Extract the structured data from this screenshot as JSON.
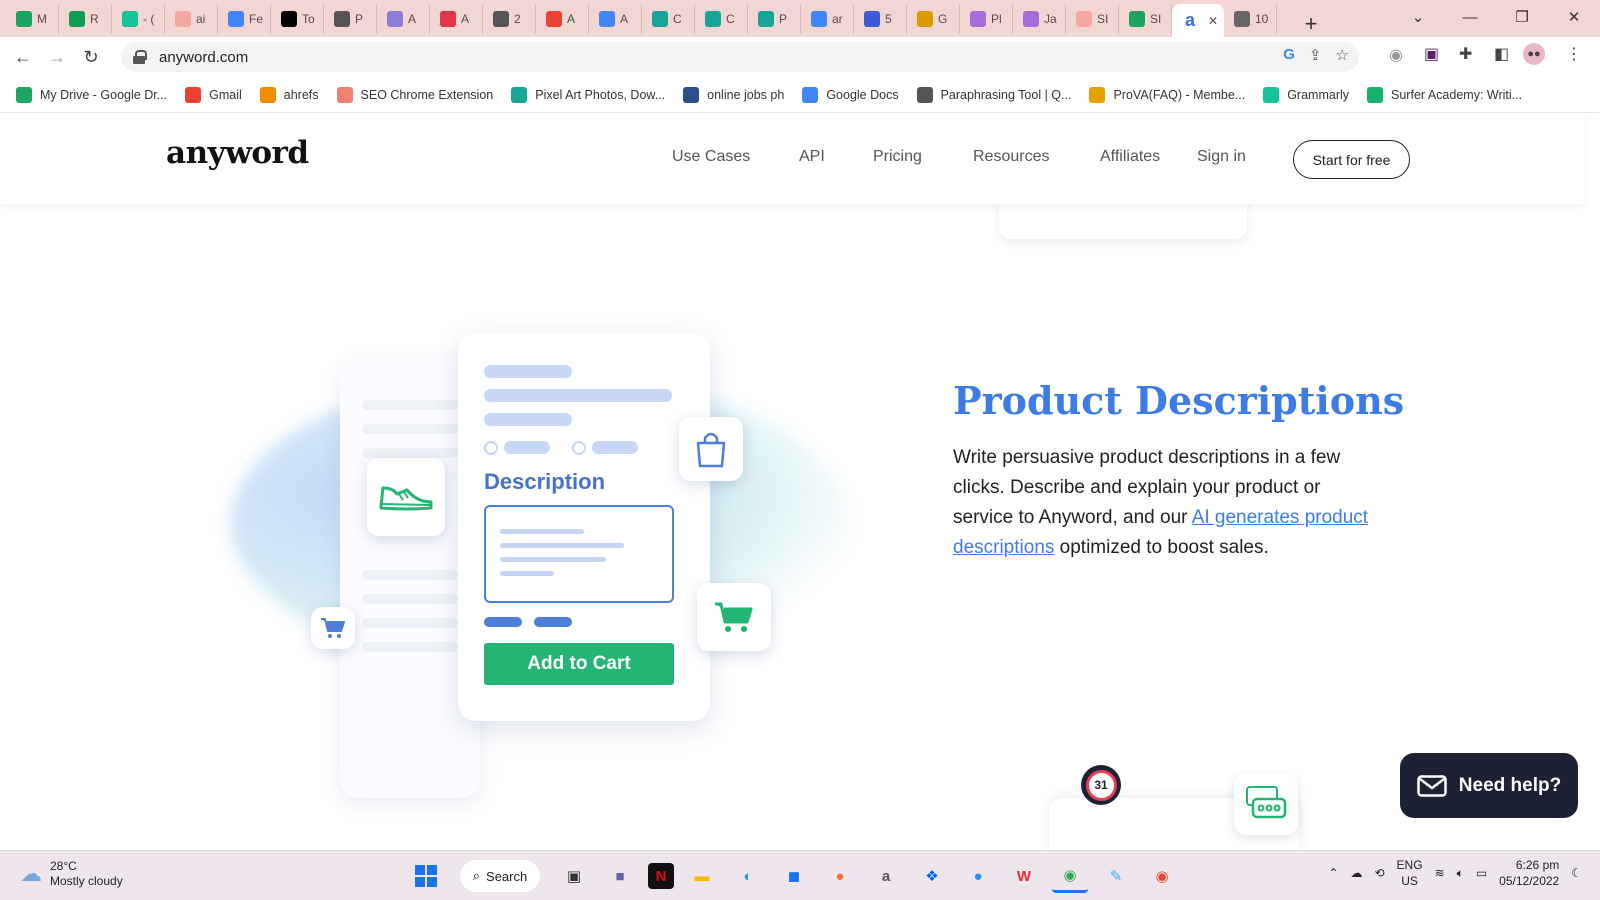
{
  "browser": {
    "tabs": [
      {
        "label": "M",
        "icon": "google-drive-icon",
        "color": "#1fa463"
      },
      {
        "label": "R",
        "icon": "sheets-icon",
        "color": "#0f9d58"
      },
      {
        "label": "- (",
        "icon": "grammarly-icon",
        "color": "#15c39a"
      },
      {
        "label": "ai",
        "icon": "doc-icon",
        "color": "#f4a7a0"
      },
      {
        "label": "Fe",
        "icon": "google-icon",
        "color": "#4285f4"
      },
      {
        "label": "To",
        "icon": "medium-icon",
        "color": "#000000"
      },
      {
        "label": "P",
        "icon": "quill-icon",
        "color": "#555555"
      },
      {
        "label": "A",
        "icon": "k-icon",
        "color": "#8b7ed8"
      },
      {
        "label": "A",
        "icon": "zyro-icon",
        "color": "#e3364b"
      },
      {
        "label": "2",
        "icon": "scissor-icon",
        "color": "#555555"
      },
      {
        "label": "A",
        "icon": "g-red-icon",
        "color": "#ea4335"
      },
      {
        "label": "A",
        "icon": "google-docs-icon",
        "color": "#4285f4"
      },
      {
        "label": "C",
        "icon": "pixel-icon",
        "color": "#18a497"
      },
      {
        "label": "C",
        "icon": "pixel-icon",
        "color": "#18a497"
      },
      {
        "label": "P",
        "icon": "pixel-icon",
        "color": "#18a497"
      },
      {
        "label": "ar",
        "icon": "google-icon",
        "color": "#4285f4"
      },
      {
        "label": "5",
        "icon": "bars-icon",
        "color": "#3d5ad8"
      },
      {
        "label": "G",
        "icon": "ttu-icon",
        "color": "#d99a00"
      },
      {
        "label": "Pl",
        "icon": "circle-icon",
        "color": "#a66cd8"
      },
      {
        "label": "Ja",
        "icon": "circle-icon",
        "color": "#a66cd8"
      },
      {
        "label": "SI",
        "icon": "doc-icon",
        "color": "#f4a7a0"
      },
      {
        "label": "SI",
        "icon": "google-drive-icon",
        "color": "#1fa463"
      },
      {
        "label": "",
        "icon": "anyword-icon",
        "color": "#3b6fe0",
        "active": true
      },
      {
        "label": "10",
        "icon": "globe-icon",
        "color": "#666666"
      }
    ],
    "new_tab": "+",
    "url": "anyword.com",
    "bookmarks": [
      {
        "label": "My Drive - Google Dr...",
        "icon": "google-drive-icon",
        "color": "#1fa463"
      },
      {
        "label": "Gmail",
        "icon": "gmail-icon",
        "color": "#ea4335"
      },
      {
        "label": "ahrefs",
        "icon": "ahrefs-icon",
        "color": "#f28b00"
      },
      {
        "label": "SEO Chrome Extension",
        "icon": "seo-icon",
        "color": "#f08070"
      },
      {
        "label": "Pixel Art Photos, Dow...",
        "icon": "pixel-icon",
        "color": "#18a497"
      },
      {
        "label": "online jobs ph",
        "icon": "onlinejobs-icon",
        "color": "#2b4f8c"
      },
      {
        "label": "Google Docs",
        "icon": "google-docs-icon",
        "color": "#4285f4"
      },
      {
        "label": "Paraphrasing Tool | Q...",
        "icon": "quill-icon",
        "color": "#555555"
      },
      {
        "label": "ProVA(FAQ) - Membe...",
        "icon": "prova-icon",
        "color": "#e8a200"
      },
      {
        "label": "Grammarly",
        "icon": "grammarly-icon",
        "color": "#15c39a"
      },
      {
        "label": "Surfer Academy: Writi...",
        "icon": "surfer-icon",
        "color": "#17b26a"
      }
    ]
  },
  "site": {
    "logo": "anyword",
    "nav": [
      "Use Cases",
      "API",
      "Pricing",
      "Resources",
      "Affiliates",
      "Sign in"
    ],
    "cta": "Start for free",
    "illustration": {
      "description_label": "Description",
      "button_label": "Add to Cart"
    },
    "section": {
      "heading": "Product Descriptions",
      "text_before": "Write persuasive product descriptions in a few clicks. Describe and explain your product or service to Anyword, and our ",
      "link_text": "AI generates product descriptions",
      "text_after": " optimized to boost sales."
    },
    "badge_number": "31",
    "help_button": "Need help?",
    "colors": {
      "accent": "#3d7be6",
      "cta_green": "#22b573",
      "dark": "#1c2233"
    }
  },
  "taskbar": {
    "weather_temp": "28°C",
    "weather_desc": "Mostly cloudy",
    "search_label": "Search",
    "lang_top": "ENG",
    "lang_bottom": "US",
    "time": "6:26 pm",
    "date": "05/12/2022"
  }
}
